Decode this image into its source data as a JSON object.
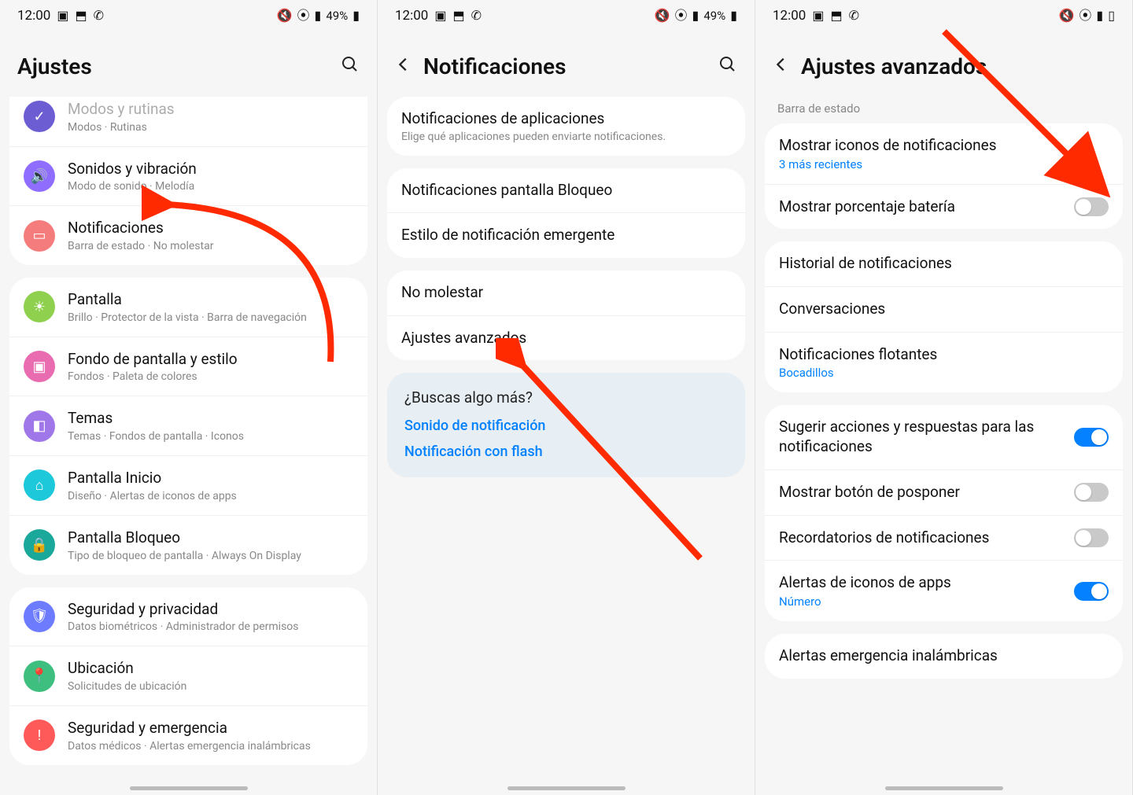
{
  "status": {
    "time": "12:00",
    "battery_text": "49%"
  },
  "screen1": {
    "title": "Ajustes",
    "group1": [
      {
        "title": "Modos y rutinas",
        "subtitle": "Modos · Rutinas",
        "color": "#6d5dd3",
        "name": "modos-rutinas",
        "glyph": "✓"
      },
      {
        "title": "Sonidos y vibración",
        "subtitle": "Modo de sonido · Melodía",
        "color": "#8f6dff",
        "name": "sonidos",
        "glyph": "🔊"
      },
      {
        "title": "Notificaciones",
        "subtitle": "Barra de estado · No molestar",
        "color": "#f47c7c",
        "name": "notificaciones",
        "glyph": "▭"
      }
    ],
    "group2": [
      {
        "title": "Pantalla",
        "subtitle": "Brillo · Protector de la vista · Barra de navegación",
        "color": "#8fd14f",
        "name": "pantalla",
        "glyph": "☀"
      },
      {
        "title": "Fondo de pantalla y estilo",
        "subtitle": "Fondos · Paleta de colores",
        "color": "#e96bb0",
        "name": "fondo",
        "glyph": "▣"
      },
      {
        "title": "Temas",
        "subtitle": "Temas · Fondos de pantalla · Iconos",
        "color": "#a077e8",
        "name": "temas",
        "glyph": "◧"
      },
      {
        "title": "Pantalla Inicio",
        "subtitle": "Diseño · Alertas de iconos de apps",
        "color": "#1cc8d9",
        "name": "pantalla-inicio",
        "glyph": "⌂"
      },
      {
        "title": "Pantalla Bloqueo",
        "subtitle": "Tipo de bloqueo de pantalla · Always On Display",
        "color": "#1aa89b",
        "name": "pantalla-bloqueo",
        "glyph": "🔒"
      }
    ],
    "group3": [
      {
        "title": "Seguridad y privacidad",
        "subtitle": "Datos biométricos · Administrador de permisos",
        "color": "#6d7cff",
        "name": "seguridad",
        "glyph": "🛡"
      },
      {
        "title": "Ubicación",
        "subtitle": "Solicitudes de ubicación",
        "color": "#3fbf7f",
        "name": "ubicacion",
        "glyph": "📍"
      },
      {
        "title": "Seguridad y emergencia",
        "subtitle": "Datos médicos · Alertas emergencia inalámbricas",
        "color": "#ff5a5a",
        "name": "emergencia",
        "glyph": "!"
      }
    ]
  },
  "screen2": {
    "title": "Notificaciones",
    "group1": [
      {
        "title": "Notificaciones de aplicaciones",
        "subtitle": "Elige qué aplicaciones pueden enviarte notificaciones.",
        "name": "notif-apps"
      }
    ],
    "group2": [
      {
        "title": "Notificaciones pantalla Bloqueo",
        "name": "notif-bloqueo"
      },
      {
        "title": "Estilo de notificación emergente",
        "name": "notif-emergente"
      }
    ],
    "group3": [
      {
        "title": "No molestar",
        "name": "no-molestar"
      },
      {
        "title": "Ajustes avanzados",
        "name": "ajustes-avanzados"
      }
    ],
    "more": {
      "question": "¿Buscas algo más?",
      "links": [
        "Sonido de notificación",
        "Notificación con flash"
      ]
    }
  },
  "screen3": {
    "title": "Ajustes avanzados",
    "section_label": "Barra de estado",
    "group1": [
      {
        "title": "Mostrar iconos de notificaciones",
        "link": "3 más recientes",
        "name": "mostrar-iconos"
      },
      {
        "title": "Mostrar porcentaje batería",
        "name": "porcentaje-bateria",
        "toggle": false
      }
    ],
    "group2": [
      {
        "title": "Historial de notificaciones",
        "name": "historial"
      },
      {
        "title": "Conversaciones",
        "name": "conversaciones"
      },
      {
        "title": "Notificaciones flotantes",
        "link": "Bocadillos",
        "name": "flotantes"
      }
    ],
    "group3": [
      {
        "title": "Sugerir acciones y respuestas para las notificaciones",
        "name": "sugerir",
        "toggle": true
      },
      {
        "title": "Mostrar botón de posponer",
        "name": "posponer",
        "toggle": false
      },
      {
        "title": "Recordatorios de notificaciones",
        "name": "recordatorios",
        "toggle": false
      },
      {
        "title": "Alertas de iconos de apps",
        "link": "Número",
        "name": "alertas-iconos",
        "toggle": true
      }
    ],
    "group4": [
      {
        "title": "Alertas emergencia inalámbricas",
        "name": "alertas-emergencia"
      }
    ]
  }
}
